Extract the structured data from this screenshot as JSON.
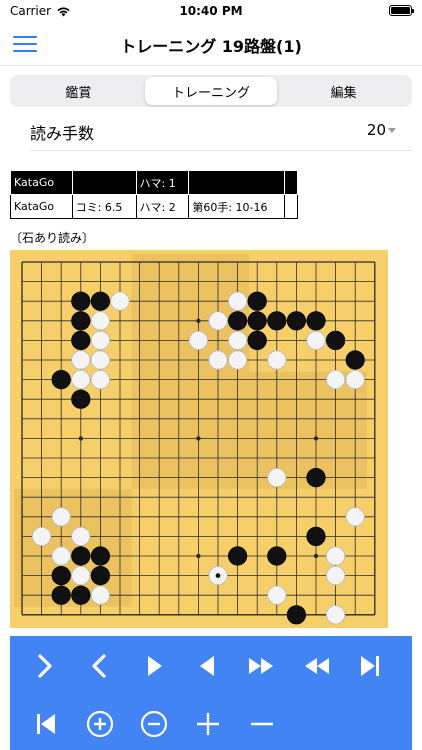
{
  "status_bar": {
    "carrier": "Carrier",
    "time": "10:40 PM"
  },
  "nav": {
    "title": "トレーニング 19路盤(1)"
  },
  "segments": [
    "鑑賞",
    "トレーニング",
    "編集"
  ],
  "selected_segment": "トレーニング",
  "setting": {
    "label": "読み手数",
    "value": "20"
  },
  "engine_table": {
    "rows": [
      [
        "KataGo",
        "",
        "ハマ: 1",
        "",
        ""
      ],
      [
        "KataGo",
        "コミ: 6.5",
        "ハマ: 2",
        "第60手: 10-16",
        ""
      ]
    ]
  },
  "board": {
    "label": "〔石あり読み〕",
    "size": 19,
    "stones": [
      {
        "col": 3,
        "row": 2,
        "color": "black"
      },
      {
        "col": 4,
        "row": 2,
        "color": "black"
      },
      {
        "col": 5,
        "row": 2,
        "color": "white"
      },
      {
        "col": 11,
        "row": 2,
        "color": "white"
      },
      {
        "col": 12,
        "row": 2,
        "color": "black"
      },
      {
        "col": 3,
        "row": 3,
        "color": "black"
      },
      {
        "col": 4,
        "row": 3,
        "color": "white"
      },
      {
        "col": 10,
        "row": 3,
        "color": "white"
      },
      {
        "col": 11,
        "row": 3,
        "color": "black"
      },
      {
        "col": 12,
        "row": 3,
        "color": "black"
      },
      {
        "col": 13,
        "row": 3,
        "color": "black"
      },
      {
        "col": 14,
        "row": 3,
        "color": "black"
      },
      {
        "col": 15,
        "row": 3,
        "color": "black"
      },
      {
        "col": 3,
        "row": 4,
        "color": "black"
      },
      {
        "col": 4,
        "row": 4,
        "color": "white"
      },
      {
        "col": 9,
        "row": 4,
        "color": "white"
      },
      {
        "col": 11,
        "row": 4,
        "color": "white"
      },
      {
        "col": 12,
        "row": 4,
        "color": "black"
      },
      {
        "col": 15,
        "row": 4,
        "color": "white"
      },
      {
        "col": 16,
        "row": 4,
        "color": "black"
      },
      {
        "col": 3,
        "row": 5,
        "color": "white"
      },
      {
        "col": 4,
        "row": 5,
        "color": "white"
      },
      {
        "col": 10,
        "row": 5,
        "color": "white"
      },
      {
        "col": 11,
        "row": 5,
        "color": "white"
      },
      {
        "col": 13,
        "row": 5,
        "color": "white"
      },
      {
        "col": 17,
        "row": 5,
        "color": "black"
      },
      {
        "col": 2,
        "row": 6,
        "color": "black"
      },
      {
        "col": 3,
        "row": 6,
        "color": "white"
      },
      {
        "col": 4,
        "row": 6,
        "color": "white"
      },
      {
        "col": 16,
        "row": 6,
        "color": "white"
      },
      {
        "col": 17,
        "row": 6,
        "color": "white"
      },
      {
        "col": 3,
        "row": 7,
        "color": "black"
      },
      {
        "col": 13,
        "row": 11,
        "color": "white"
      },
      {
        "col": 15,
        "row": 11,
        "color": "black"
      },
      {
        "col": 2,
        "row": 13,
        "color": "white"
      },
      {
        "col": 17,
        "row": 13,
        "color": "white"
      },
      {
        "col": 1,
        "row": 14,
        "color": "white"
      },
      {
        "col": 3,
        "row": 14,
        "color": "white"
      },
      {
        "col": 15,
        "row": 14,
        "color": "black"
      },
      {
        "col": 2,
        "row": 15,
        "color": "white"
      },
      {
        "col": 3,
        "row": 15,
        "color": "black"
      },
      {
        "col": 4,
        "row": 15,
        "color": "black"
      },
      {
        "col": 11,
        "row": 15,
        "color": "black"
      },
      {
        "col": 13,
        "row": 15,
        "color": "black"
      },
      {
        "col": 16,
        "row": 15,
        "color": "white"
      },
      {
        "col": 2,
        "row": 16,
        "color": "black"
      },
      {
        "col": 3,
        "row": 16,
        "color": "white"
      },
      {
        "col": 4,
        "row": 16,
        "color": "black"
      },
      {
        "col": 10,
        "row": 16,
        "color": "white",
        "last_move": true
      },
      {
        "col": 16,
        "row": 16,
        "color": "white"
      },
      {
        "col": 2,
        "row": 17,
        "color": "black"
      },
      {
        "col": 3,
        "row": 17,
        "color": "black"
      },
      {
        "col": 4,
        "row": 17,
        "color": "white"
      },
      {
        "col": 13,
        "row": 17,
        "color": "white"
      },
      {
        "col": 14,
        "row": 18,
        "color": "black"
      },
      {
        "col": 16,
        "row": 18,
        "color": "white"
      }
    ],
    "colors": {
      "board": "#f6cf6b",
      "board_dark": "#ecc261",
      "line": "#2a2a2a",
      "black": "#111111",
      "white": "#f4f4f4"
    }
  },
  "toolbar": {
    "background": "#4284f3",
    "buttons": [
      {
        "name": "forward-one",
        "icon": "chevron-right"
      },
      {
        "name": "back-one",
        "icon": "chevron-left"
      },
      {
        "name": "play",
        "icon": "play"
      },
      {
        "name": "reverse",
        "icon": "play-left"
      },
      {
        "name": "fast-forward",
        "icon": "fast-forward"
      },
      {
        "name": "rewind",
        "icon": "rewind"
      },
      {
        "name": "to-end",
        "icon": "skip-end"
      },
      {
        "name": "to-start",
        "icon": "skip-start"
      },
      {
        "name": "zoom-in",
        "icon": "plus-circle"
      },
      {
        "name": "zoom-out",
        "icon": "minus-circle"
      },
      {
        "name": "add",
        "icon": "plus"
      },
      {
        "name": "remove",
        "icon": "minus"
      }
    ]
  }
}
